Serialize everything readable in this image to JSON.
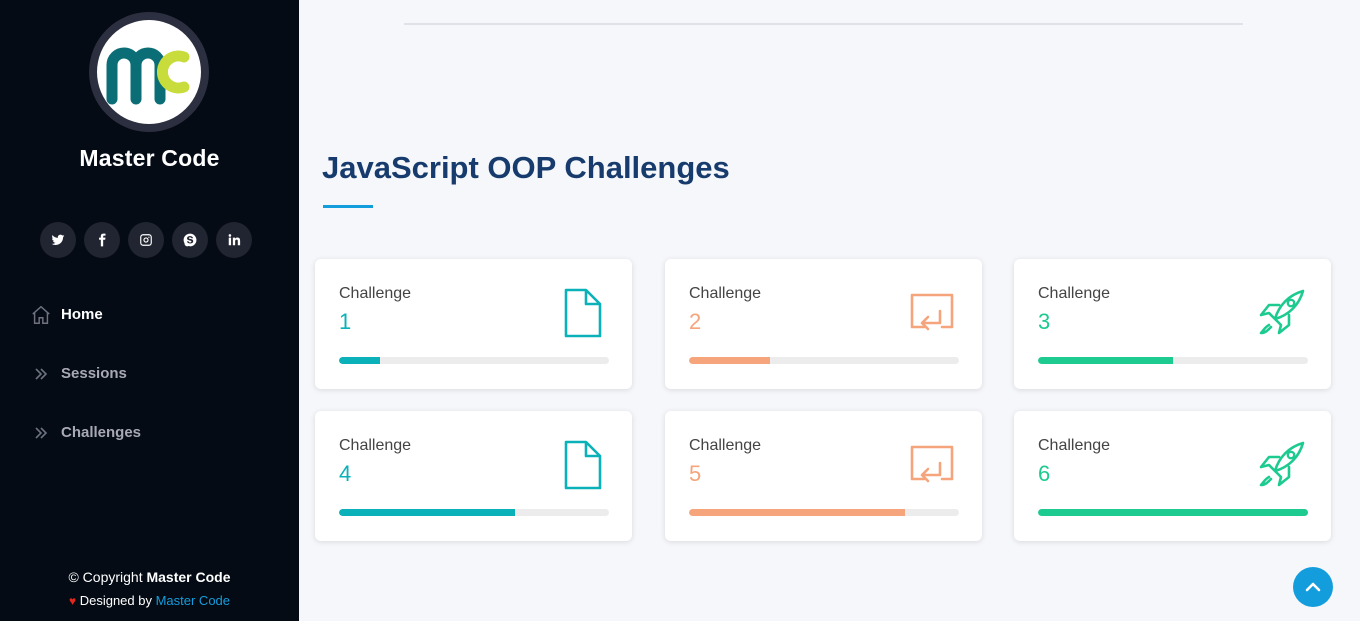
{
  "sidebar": {
    "logo_text": "mc",
    "brand": "Master Code",
    "social": [
      {
        "icon": "twitter-icon"
      },
      {
        "icon": "facebook-icon"
      },
      {
        "icon": "instagram-icon"
      },
      {
        "icon": "skype-icon"
      },
      {
        "icon": "linkedin-icon"
      }
    ],
    "nav": [
      {
        "label": "Home",
        "icon": "home-icon"
      },
      {
        "label": "Sessions",
        "icon": "double-chevron-right-icon"
      },
      {
        "label": "Challenges",
        "icon": "double-chevron-right-icon"
      }
    ],
    "footer": {
      "copyright_prefix": "© Copyright ",
      "copyright_name": "Master Code",
      "heart": "♥",
      "designed_prefix": " Designed by ",
      "designed_link": "Master Code"
    }
  },
  "main": {
    "title": "JavaScript OOP Challenges",
    "cards": [
      {
        "label": "Challenge",
        "number": "1",
        "icon": "file-icon",
        "color": "#0ab1b8",
        "progress": 0.15
      },
      {
        "label": "Challenge",
        "number": "2",
        "icon": "return-screen-icon",
        "color": "#f5a47c",
        "progress": 0.3
      },
      {
        "label": "Challenge",
        "number": "3",
        "icon": "rocket-icon",
        "color": "#1dca8f",
        "progress": 0.5
      },
      {
        "label": "Challenge",
        "number": "4",
        "icon": "file-icon",
        "color": "#0ab1b8",
        "progress": 0.65
      },
      {
        "label": "Challenge",
        "number": "5",
        "icon": "return-screen-icon",
        "color": "#f5a47c",
        "progress": 0.8
      },
      {
        "label": "Challenge",
        "number": "6",
        "icon": "rocket-icon",
        "color": "#1dca8f",
        "progress": 1.0
      }
    ]
  },
  "colors": {
    "sidebar_bg": "#040b14",
    "accent": "#149ddd",
    "title": "#173b6c"
  }
}
